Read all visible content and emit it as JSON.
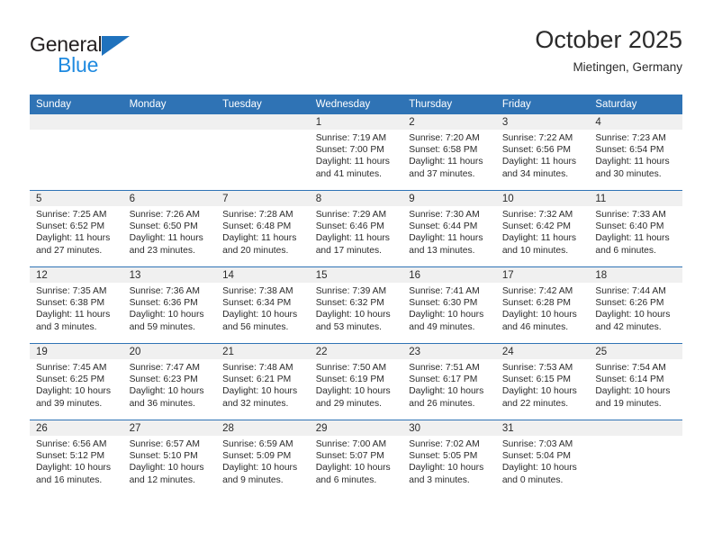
{
  "brand": {
    "name_part1": "General",
    "name_part2": "Blue",
    "triangle_color": "#1f72bd",
    "part1_color": "#231f20",
    "part2_color": "#1f8ae0"
  },
  "header": {
    "title": "October 2025",
    "subtitle": "Mietingen, Germany"
  },
  "theme": {
    "header_bg": "#2f73b5",
    "header_text": "#ffffff",
    "daynum_band_bg": "#f0f0f0",
    "row_divider": "#2f73b5",
    "body_text": "#2b2b2b",
    "page_bg": "#ffffff"
  },
  "calendar": {
    "weekday_headers": [
      "Sunday",
      "Monday",
      "Tuesday",
      "Wednesday",
      "Thursday",
      "Friday",
      "Saturday"
    ],
    "labels": {
      "sunrise": "Sunrise:",
      "sunset": "Sunset:",
      "daylight": "Daylight:"
    },
    "weeks": [
      [
        {
          "day": "",
          "sunrise": "",
          "sunset": "",
          "daylight": "",
          "empty": true
        },
        {
          "day": "",
          "sunrise": "",
          "sunset": "",
          "daylight": "",
          "empty": true
        },
        {
          "day": "",
          "sunrise": "",
          "sunset": "",
          "daylight": "",
          "empty": true
        },
        {
          "day": "1",
          "sunrise": "Sunrise: 7:19 AM",
          "sunset": "Sunset: 7:00 PM",
          "daylight": "Daylight: 11 hours and 41 minutes."
        },
        {
          "day": "2",
          "sunrise": "Sunrise: 7:20 AM",
          "sunset": "Sunset: 6:58 PM",
          "daylight": "Daylight: 11 hours and 37 minutes."
        },
        {
          "day": "3",
          "sunrise": "Sunrise: 7:22 AM",
          "sunset": "Sunset: 6:56 PM",
          "daylight": "Daylight: 11 hours and 34 minutes."
        },
        {
          "day": "4",
          "sunrise": "Sunrise: 7:23 AM",
          "sunset": "Sunset: 6:54 PM",
          "daylight": "Daylight: 11 hours and 30 minutes."
        }
      ],
      [
        {
          "day": "5",
          "sunrise": "Sunrise: 7:25 AM",
          "sunset": "Sunset: 6:52 PM",
          "daylight": "Daylight: 11 hours and 27 minutes."
        },
        {
          "day": "6",
          "sunrise": "Sunrise: 7:26 AM",
          "sunset": "Sunset: 6:50 PM",
          "daylight": "Daylight: 11 hours and 23 minutes."
        },
        {
          "day": "7",
          "sunrise": "Sunrise: 7:28 AM",
          "sunset": "Sunset: 6:48 PM",
          "daylight": "Daylight: 11 hours and 20 minutes."
        },
        {
          "day": "8",
          "sunrise": "Sunrise: 7:29 AM",
          "sunset": "Sunset: 6:46 PM",
          "daylight": "Daylight: 11 hours and 17 minutes."
        },
        {
          "day": "9",
          "sunrise": "Sunrise: 7:30 AM",
          "sunset": "Sunset: 6:44 PM",
          "daylight": "Daylight: 11 hours and 13 minutes."
        },
        {
          "day": "10",
          "sunrise": "Sunrise: 7:32 AM",
          "sunset": "Sunset: 6:42 PM",
          "daylight": "Daylight: 11 hours and 10 minutes."
        },
        {
          "day": "11",
          "sunrise": "Sunrise: 7:33 AM",
          "sunset": "Sunset: 6:40 PM",
          "daylight": "Daylight: 11 hours and 6 minutes."
        }
      ],
      [
        {
          "day": "12",
          "sunrise": "Sunrise: 7:35 AM",
          "sunset": "Sunset: 6:38 PM",
          "daylight": "Daylight: 11 hours and 3 minutes."
        },
        {
          "day": "13",
          "sunrise": "Sunrise: 7:36 AM",
          "sunset": "Sunset: 6:36 PM",
          "daylight": "Daylight: 10 hours and 59 minutes."
        },
        {
          "day": "14",
          "sunrise": "Sunrise: 7:38 AM",
          "sunset": "Sunset: 6:34 PM",
          "daylight": "Daylight: 10 hours and 56 minutes."
        },
        {
          "day": "15",
          "sunrise": "Sunrise: 7:39 AM",
          "sunset": "Sunset: 6:32 PM",
          "daylight": "Daylight: 10 hours and 53 minutes."
        },
        {
          "day": "16",
          "sunrise": "Sunrise: 7:41 AM",
          "sunset": "Sunset: 6:30 PM",
          "daylight": "Daylight: 10 hours and 49 minutes."
        },
        {
          "day": "17",
          "sunrise": "Sunrise: 7:42 AM",
          "sunset": "Sunset: 6:28 PM",
          "daylight": "Daylight: 10 hours and 46 minutes."
        },
        {
          "day": "18",
          "sunrise": "Sunrise: 7:44 AM",
          "sunset": "Sunset: 6:26 PM",
          "daylight": "Daylight: 10 hours and 42 minutes."
        }
      ],
      [
        {
          "day": "19",
          "sunrise": "Sunrise: 7:45 AM",
          "sunset": "Sunset: 6:25 PM",
          "daylight": "Daylight: 10 hours and 39 minutes."
        },
        {
          "day": "20",
          "sunrise": "Sunrise: 7:47 AM",
          "sunset": "Sunset: 6:23 PM",
          "daylight": "Daylight: 10 hours and 36 minutes."
        },
        {
          "day": "21",
          "sunrise": "Sunrise: 7:48 AM",
          "sunset": "Sunset: 6:21 PM",
          "daylight": "Daylight: 10 hours and 32 minutes."
        },
        {
          "day": "22",
          "sunrise": "Sunrise: 7:50 AM",
          "sunset": "Sunset: 6:19 PM",
          "daylight": "Daylight: 10 hours and 29 minutes."
        },
        {
          "day": "23",
          "sunrise": "Sunrise: 7:51 AM",
          "sunset": "Sunset: 6:17 PM",
          "daylight": "Daylight: 10 hours and 26 minutes."
        },
        {
          "day": "24",
          "sunrise": "Sunrise: 7:53 AM",
          "sunset": "Sunset: 6:15 PM",
          "daylight": "Daylight: 10 hours and 22 minutes."
        },
        {
          "day": "25",
          "sunrise": "Sunrise: 7:54 AM",
          "sunset": "Sunset: 6:14 PM",
          "daylight": "Daylight: 10 hours and 19 minutes."
        }
      ],
      [
        {
          "day": "26",
          "sunrise": "Sunrise: 6:56 AM",
          "sunset": "Sunset: 5:12 PM",
          "daylight": "Daylight: 10 hours and 16 minutes."
        },
        {
          "day": "27",
          "sunrise": "Sunrise: 6:57 AM",
          "sunset": "Sunset: 5:10 PM",
          "daylight": "Daylight: 10 hours and 12 minutes."
        },
        {
          "day": "28",
          "sunrise": "Sunrise: 6:59 AM",
          "sunset": "Sunset: 5:09 PM",
          "daylight": "Daylight: 10 hours and 9 minutes."
        },
        {
          "day": "29",
          "sunrise": "Sunrise: 7:00 AM",
          "sunset": "Sunset: 5:07 PM",
          "daylight": "Daylight: 10 hours and 6 minutes."
        },
        {
          "day": "30",
          "sunrise": "Sunrise: 7:02 AM",
          "sunset": "Sunset: 5:05 PM",
          "daylight": "Daylight: 10 hours and 3 minutes."
        },
        {
          "day": "31",
          "sunrise": "Sunrise: 7:03 AM",
          "sunset": "Sunset: 5:04 PM",
          "daylight": "Daylight: 10 hours and 0 minutes."
        },
        {
          "day": "",
          "sunrise": "",
          "sunset": "",
          "daylight": "",
          "empty": true
        }
      ]
    ]
  }
}
